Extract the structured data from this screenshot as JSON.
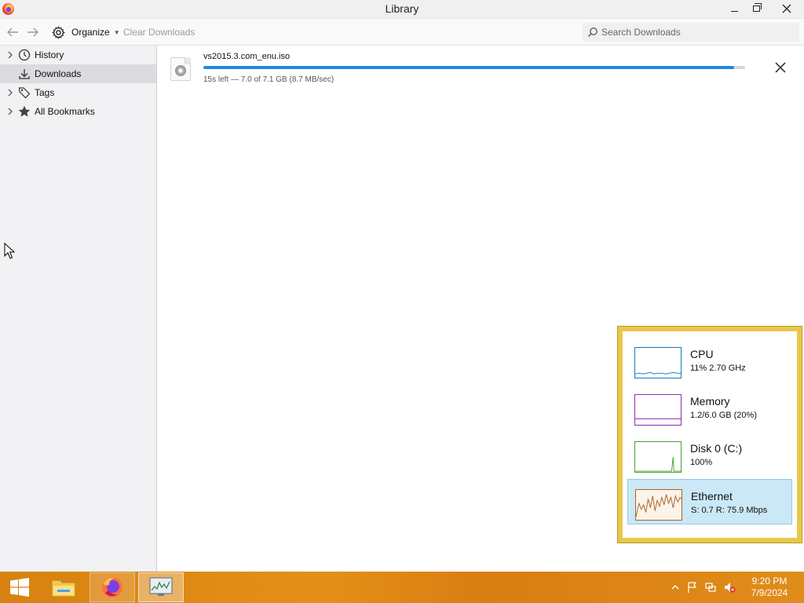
{
  "window": {
    "title": "Library",
    "app_icon": "firefox-icon"
  },
  "toolbar": {
    "back_icon": "back-arrow-icon",
    "forward_icon": "forward-arrow-icon",
    "organize_label": "Organize",
    "organize_icon": "gear-icon",
    "clear_label": "Clear Downloads",
    "search_placeholder": "Search Downloads",
    "search_value": ""
  },
  "sidebar": {
    "items": [
      {
        "label": "History",
        "icon": "clock-icon",
        "expandable": true
      },
      {
        "label": "Downloads",
        "icon": "download-icon",
        "expandable": false,
        "selected": true
      },
      {
        "label": "Tags",
        "icon": "tag-icon",
        "expandable": true
      },
      {
        "label": "All Bookmarks",
        "icon": "star-icon",
        "expandable": true
      }
    ]
  },
  "downloads": [
    {
      "filename": "vs2015.3.com_enu.iso",
      "status": "15s left — 7.0 of 7.1 GB (8.7 MB/sec)",
      "progress": 0.98,
      "icon": "disc-image-file-icon"
    }
  ],
  "perf_widget": {
    "rows": [
      {
        "name": "CPU",
        "value": "11% 2.70 GHz",
        "color": "#1779ba"
      },
      {
        "name": "Memory",
        "value": "1.2/6.0 GB (20%)",
        "color": "#8b2db0"
      },
      {
        "name": "Disk 0 (C:)",
        "value": "100%",
        "color": "#4da033"
      },
      {
        "name": "Ethernet",
        "value": "S: 0.7 R: 75.9 Mbps",
        "color": "#a7662b",
        "selected": true
      }
    ]
  },
  "taskbar": {
    "clock_time": "9:20 PM",
    "clock_date": "7/9/2024",
    "accent": "#e08a16"
  }
}
